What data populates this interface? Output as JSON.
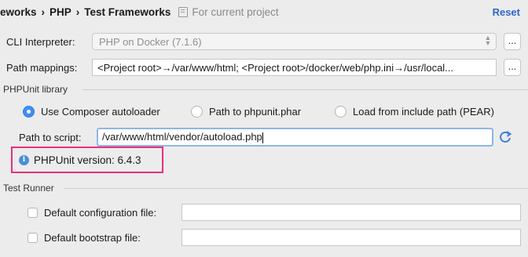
{
  "header": {
    "breadcrumb": [
      "eworks",
      "PHP",
      "Test Frameworks"
    ],
    "scope_label": "For current project",
    "reset_label": "Reset"
  },
  "cli": {
    "label": "CLI Interpreter:",
    "value": "PHP on Docker (7.1.6)",
    "more_label": "..."
  },
  "mappings": {
    "label": "Path mappings:",
    "value": "<Project root>→/var/www/html; <Project root>/docker/web/php.ini→/usr/local...",
    "more_label": "..."
  },
  "phpunit": {
    "group_title": "PHPUnit library",
    "options": [
      {
        "label": "Use Composer autoloader",
        "selected": true
      },
      {
        "label": "Path to phpunit.phar",
        "selected": false
      },
      {
        "label": "Load from include path (PEAR)",
        "selected": false
      }
    ],
    "script_label": "Path to script:",
    "script_value": "/var/www/html/vendor/autoload.php",
    "version_text": "PHPUnit version: 6.4.3"
  },
  "test_runner": {
    "group_title": "Test Runner",
    "config_label": "Default configuration file:",
    "config_checked": false,
    "bootstrap_label": "Default bootstrap file:",
    "bootstrap_checked": false
  },
  "icons": {
    "scope": "document-icon",
    "combo": "chevron-updown-icon",
    "refresh": "refresh-icon",
    "info": "info-icon"
  },
  "colors": {
    "accent": "#3d8ff5",
    "link": "#2f65ca",
    "highlight_border": "#e8307a"
  }
}
